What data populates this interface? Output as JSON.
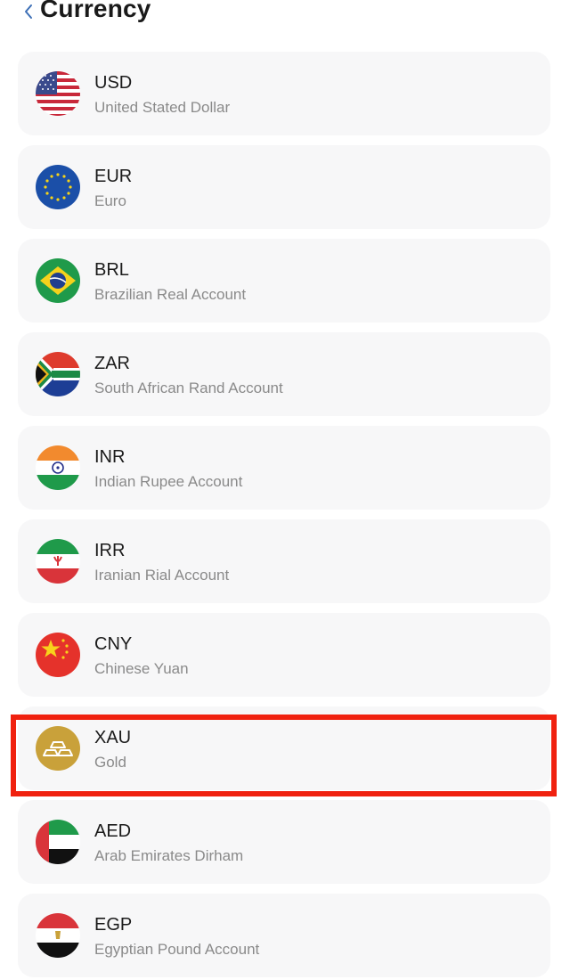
{
  "header": {
    "title": "Currency",
    "back_icon": "chevron-left-icon"
  },
  "currencies": [
    {
      "code": "USD",
      "name": "United Stated Dollar",
      "flag": "us-flag-icon"
    },
    {
      "code": "EUR",
      "name": "Euro",
      "flag": "eu-flag-icon"
    },
    {
      "code": "BRL",
      "name": "Brazilian Real Account",
      "flag": "brazil-flag-icon"
    },
    {
      "code": "ZAR",
      "name": "South African Rand Account",
      "flag": "south-africa-flag-icon"
    },
    {
      "code": "INR",
      "name": "Indian Rupee Account",
      "flag": "india-flag-icon"
    },
    {
      "code": "IRR",
      "name": "Iranian Rial Account",
      "flag": "iran-flag-icon"
    },
    {
      "code": "CNY",
      "name": "Chinese Yuan",
      "flag": "china-flag-icon"
    },
    {
      "code": "XAU",
      "name": "Gold",
      "flag": "gold-bars-icon"
    },
    {
      "code": "AED",
      "name": "Arab Emirates Dirham",
      "flag": "uae-flag-icon"
    },
    {
      "code": "EGP",
      "name": "Egyptian Pound Account",
      "flag": "egypt-flag-icon"
    }
  ],
  "highlighted": "XAU",
  "colors": {
    "accent": "#3d6fb6",
    "highlight": "#f0210f",
    "card": "#f7f7f8"
  }
}
